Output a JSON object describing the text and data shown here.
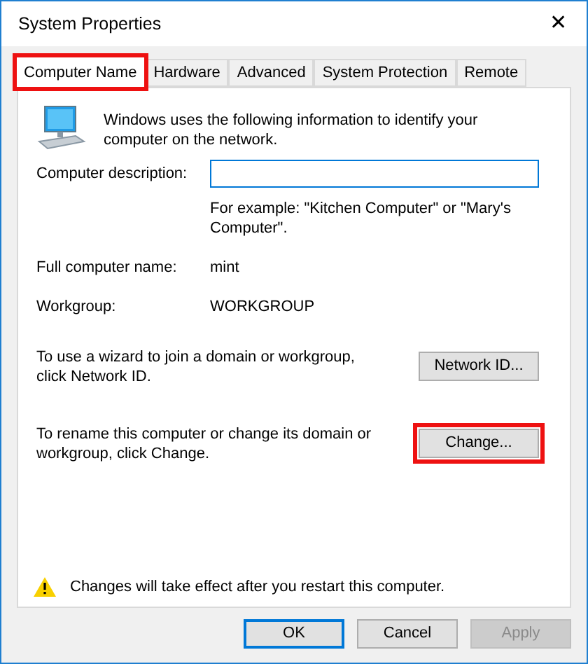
{
  "window": {
    "title": "System Properties",
    "close": "✕"
  },
  "tabs": [
    {
      "label": "Computer Name",
      "selected": true,
      "highlighted": true
    },
    {
      "label": "Hardware",
      "selected": false,
      "highlighted": false
    },
    {
      "label": "Advanced",
      "selected": false,
      "highlighted": false
    },
    {
      "label": "System Protection",
      "selected": false,
      "highlighted": false
    },
    {
      "label": "Remote",
      "selected": false,
      "highlighted": false
    }
  ],
  "intro": "Windows uses the following information to identify your computer on the network.",
  "description": {
    "label": "Computer description:",
    "hint": "For example: \"Kitchen Computer\" or \"Mary's Computer\"."
  },
  "fields": [
    {
      "label": "Full computer name:",
      "value": "mint"
    },
    {
      "label": "Workgroup:",
      "value": "WORKGROUP"
    }
  ],
  "actions": [
    {
      "text": "To use a wizard to join a domain or workgroup, click Network ID.",
      "button": "Network ID...",
      "highlighted": false
    },
    {
      "text": "To rename this computer or change its domain or workgroup, click Change.",
      "button": "Change...",
      "highlighted": true
    }
  ],
  "warning": "Changes will take effect after you restart this computer.",
  "buttons": [
    {
      "label": "OK",
      "default": true,
      "disabled": false
    },
    {
      "label": "Cancel",
      "default": false,
      "disabled": false
    },
    {
      "label": "Apply",
      "default": false,
      "disabled": true
    }
  ]
}
